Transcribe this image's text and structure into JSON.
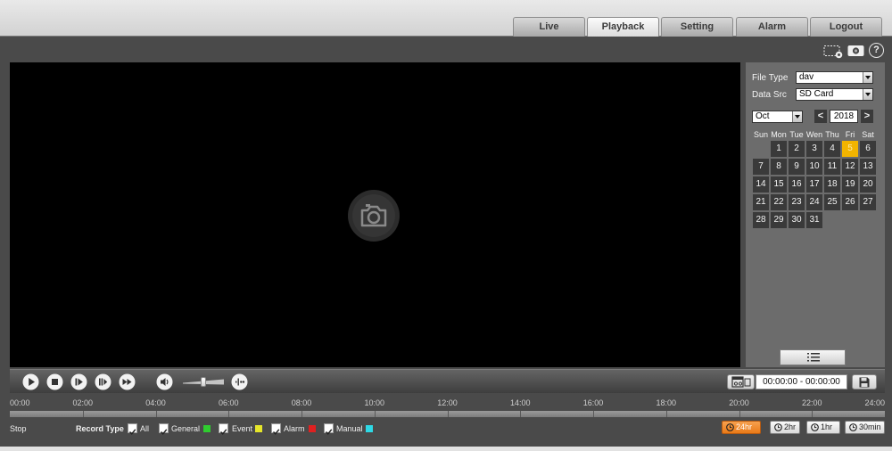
{
  "nav": {
    "tabs": [
      {
        "label": "Live",
        "active": false
      },
      {
        "label": "Playback",
        "active": true
      },
      {
        "label": "Setting",
        "active": false
      },
      {
        "label": "Alarm",
        "active": false
      },
      {
        "label": "Logout",
        "active": false
      }
    ]
  },
  "top_icons": {
    "icons": [
      "region-snapshot-icon",
      "camera-icon",
      "help-icon"
    ],
    "help_glyph": "?"
  },
  "video": {
    "placeholder_icon": "camera-placeholder-icon"
  },
  "search": {
    "file_type_label": "File Type",
    "file_type_value": "dav",
    "data_src_label": "Data Src",
    "data_src_value": "SD Card",
    "month": "Oct",
    "year": "2018",
    "prev_glyph": "<",
    "next_glyph": ">",
    "weekdays": [
      "Sun",
      "Mon",
      "Tue",
      "Wen",
      "Thu",
      "Fri",
      "Sat"
    ],
    "weeks": [
      [
        null,
        1,
        2,
        3,
        4,
        5,
        6
      ],
      [
        7,
        8,
        9,
        10,
        11,
        12,
        13
      ],
      [
        14,
        15,
        16,
        17,
        18,
        19,
        20
      ],
      [
        21,
        22,
        23,
        24,
        25,
        26,
        27
      ],
      [
        28,
        29,
        30,
        31,
        null,
        null,
        null
      ]
    ],
    "selected_day": 5,
    "list_button_icon": "file-list-icon"
  },
  "controls": {
    "icons": [
      "play-icon",
      "stop-icon",
      "next-frame-icon",
      "slow-play-icon",
      "fast-play-icon",
      "volume-icon",
      "audio-wave-icon",
      "clip-icon",
      "save-icon"
    ],
    "volume_level": 0.5,
    "time_range": "00:00:00 - 00:00:00"
  },
  "timeline": {
    "labels": [
      "00:00",
      "02:00",
      "04:00",
      "06:00",
      "08:00",
      "10:00",
      "12:00",
      "14:00",
      "16:00",
      "18:00",
      "20:00",
      "22:00",
      "24:00"
    ]
  },
  "status": {
    "state": "Stop",
    "record_type_label": "Record Type",
    "record_types": [
      {
        "label": "All",
        "checked": true
      },
      {
        "label": "General",
        "checked": true,
        "color": "#2fcc2f"
      },
      {
        "label": "Event",
        "checked": true,
        "color": "#e6e62a"
      },
      {
        "label": "Alarm",
        "checked": true,
        "color": "#e02020"
      },
      {
        "label": "Manual",
        "checked": true,
        "color": "#2ed9e6"
      }
    ]
  },
  "time_scale": {
    "options": [
      {
        "label": "24hr",
        "active": true
      },
      {
        "label": "2hr",
        "active": false
      },
      {
        "label": "1hr",
        "active": false
      },
      {
        "label": "30min",
        "active": false
      }
    ]
  },
  "colors": {
    "accent": "#f08a24",
    "selected_day": "#f2b400"
  }
}
